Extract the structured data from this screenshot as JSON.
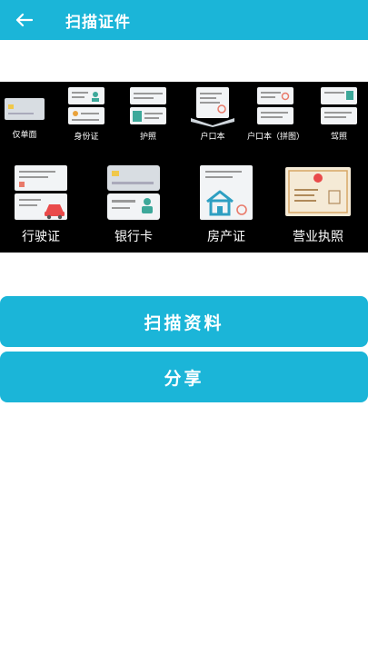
{
  "header": {
    "title": "扫描证件",
    "back_icon": "arrow-left-icon"
  },
  "banner": {
    "row1": [
      {
        "label": "仅单面",
        "icon": "single-side-card-icon"
      },
      {
        "label": "身份证",
        "icon": "id-card-icon"
      },
      {
        "label": "护照",
        "icon": "passport-icon"
      },
      {
        "label": "户口本",
        "icon": "household-register-icon"
      },
      {
        "label": "户口本（拼图）",
        "icon": "household-register-collage-icon"
      },
      {
        "label": "驾照",
        "icon": "driver-license-icon"
      }
    ],
    "row2": [
      {
        "label": "行驶证",
        "icon": "vehicle-license-icon"
      },
      {
        "label": "银行卡",
        "icon": "bank-card-icon"
      },
      {
        "label": "房产证",
        "icon": "property-certificate-icon"
      },
      {
        "label": "营业执照",
        "icon": "business-license-icon"
      }
    ]
  },
  "actions": {
    "scan_label": "扫描资料",
    "share_label": "分享"
  },
  "colors": {
    "accent": "#1bb5d8",
    "banner_bg": "#000000"
  }
}
